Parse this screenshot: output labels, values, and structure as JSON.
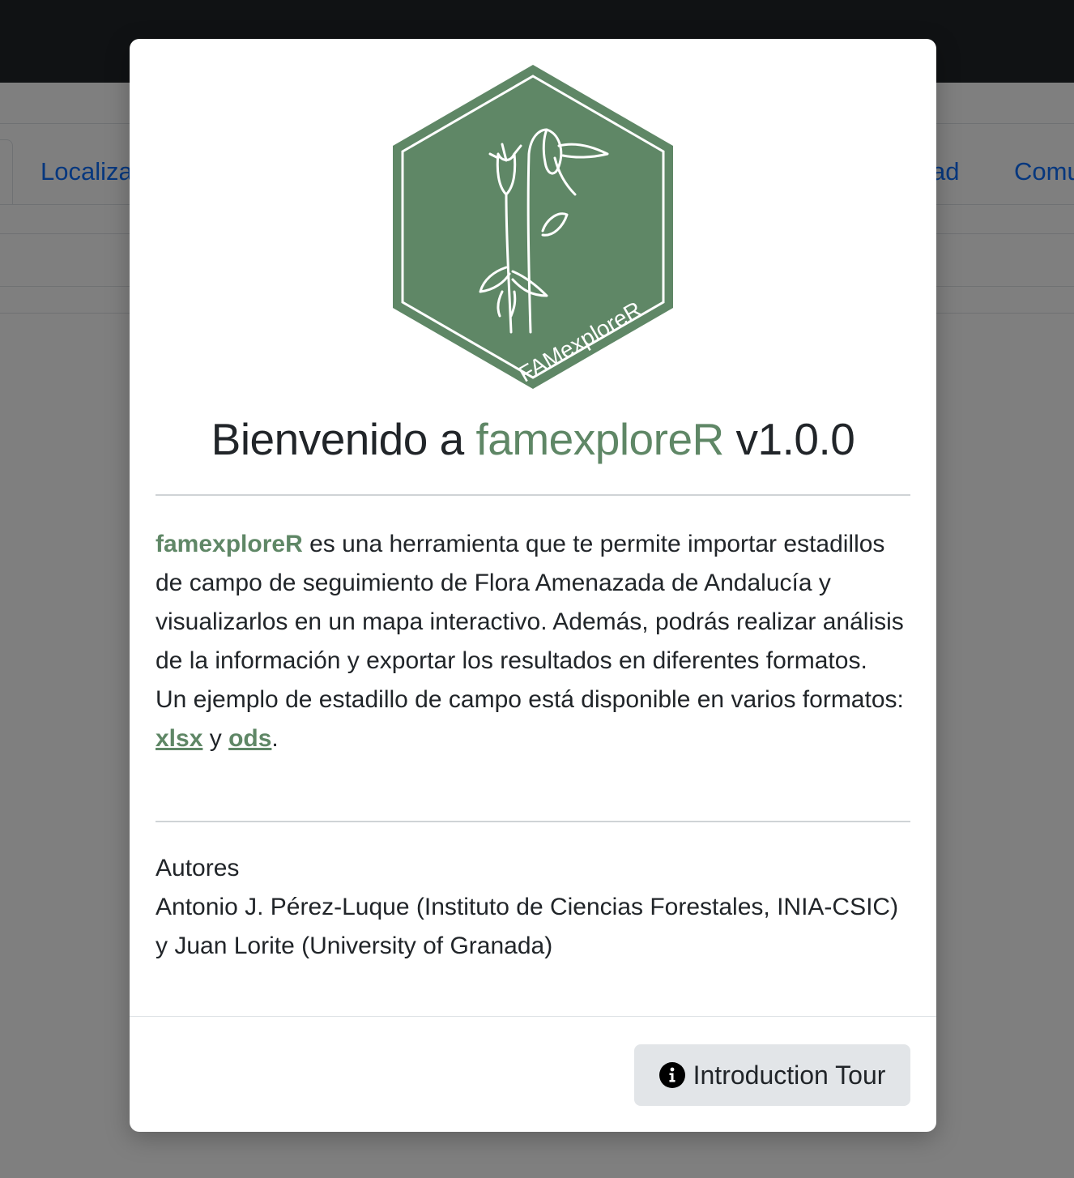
{
  "background": {
    "tabs": [
      {
        "label": "Localiza"
      },
      {
        "label": "ad"
      },
      {
        "label": "Comu"
      }
    ]
  },
  "modal": {
    "logo_text": "FAMexploreR",
    "title": {
      "prefix": "Bienvenido a ",
      "app_name": "famexploreR",
      "version": " v1.0.0"
    },
    "description": {
      "app_name": "famexploreR",
      "text1": " es una herramienta que te permite importar estadillos de campo de seguimiento de Flora Amenazada de Andalucía y visualizarlos en un mapa interactivo. Además, podrás realizar análisis de la información y exportar los resultados en diferentes formatos.",
      "text2": "Un ejemplo de estadillo de campo está disponible en varios formatos: ",
      "link_xlsx": "xlsx",
      "sep": " y ",
      "link_ods": "ods",
      "end": "."
    },
    "authors": {
      "heading": "Autores",
      "text": "Antonio J. Pérez-Luque (Instituto de Ciencias Forestales, INIA-CSIC) y Juan Lorite (University of Granada)"
    },
    "tour_button": "Introduction Tour"
  },
  "colors": {
    "accent_green": "#5f8766",
    "link_blue": "#0d6efd",
    "topbar": "#212529"
  }
}
